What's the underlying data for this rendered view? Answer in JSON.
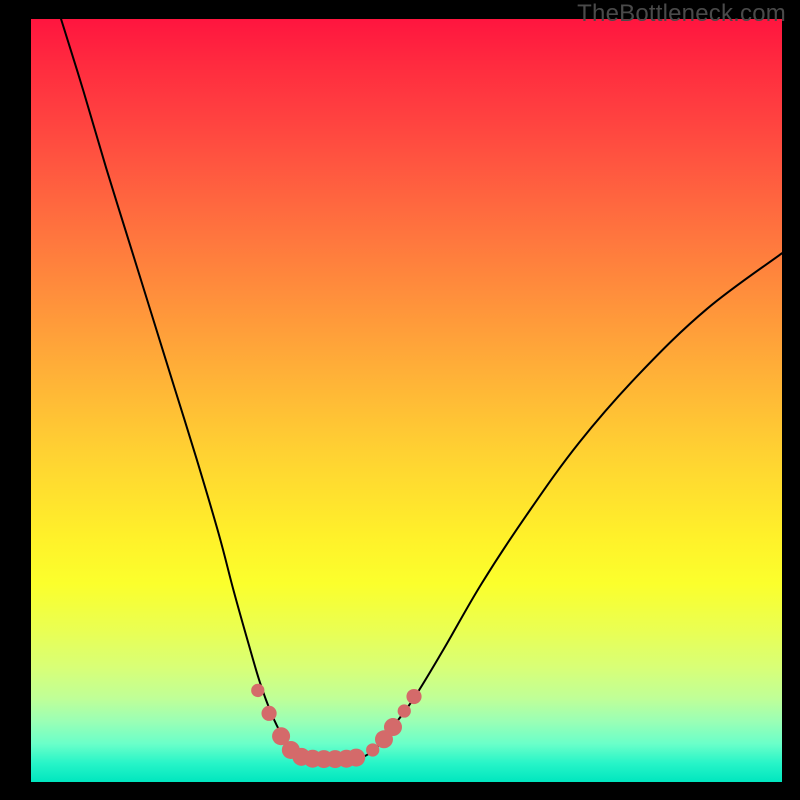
{
  "watermark": "TheBottleneck.com",
  "colors": {
    "curve": "#000000",
    "marker_fill": "#d46a6a",
    "marker_stroke": "#c15a5a"
  },
  "chart_data": {
    "type": "line",
    "title": "",
    "xlabel": "",
    "ylabel": "",
    "xlim": [
      0,
      100
    ],
    "ylim": [
      0,
      100
    ],
    "series": [
      {
        "name": "left-curve",
        "x": [
          4,
          7,
          10,
          13,
          16,
          19,
          22,
          25,
          27,
          29,
          30.5,
          32,
          33.5,
          35,
          36
        ],
        "y": [
          100,
          90.5,
          80.5,
          71,
          61.5,
          52,
          42.5,
          32.5,
          25,
          18,
          13,
          9,
          6,
          4,
          3.2
        ]
      },
      {
        "name": "floor",
        "x": [
          36,
          38,
          40,
          42,
          44
        ],
        "y": [
          3.2,
          3.0,
          3.0,
          3.0,
          3.2
        ]
      },
      {
        "name": "right-curve",
        "x": [
          44,
          46,
          48,
          51,
          55,
          60,
          66,
          73,
          81,
          90,
          100
        ],
        "y": [
          3.2,
          4.5,
          7,
          11,
          17.5,
          26,
          35,
          44.5,
          53.5,
          62,
          69.3
        ]
      }
    ],
    "markers": [
      {
        "x": 30.2,
        "y": 12.0,
        "r": 1.4
      },
      {
        "x": 31.7,
        "y": 9.0,
        "r": 1.6
      },
      {
        "x": 33.3,
        "y": 6.0,
        "r": 1.9
      },
      {
        "x": 34.6,
        "y": 4.2,
        "r": 1.9
      },
      {
        "x": 36.0,
        "y": 3.3,
        "r": 1.9
      },
      {
        "x": 37.5,
        "y": 3.05,
        "r": 1.9
      },
      {
        "x": 39.0,
        "y": 3.0,
        "r": 1.9
      },
      {
        "x": 40.5,
        "y": 3.0,
        "r": 1.9
      },
      {
        "x": 42.0,
        "y": 3.05,
        "r": 1.9
      },
      {
        "x": 43.3,
        "y": 3.2,
        "r": 1.9
      },
      {
        "x": 45.5,
        "y": 4.2,
        "r": 1.4
      },
      {
        "x": 47.0,
        "y": 5.6,
        "r": 1.9
      },
      {
        "x": 48.2,
        "y": 7.2,
        "r": 1.9
      },
      {
        "x": 49.7,
        "y": 9.3,
        "r": 1.4
      },
      {
        "x": 51.0,
        "y": 11.2,
        "r": 1.6
      }
    ]
  }
}
